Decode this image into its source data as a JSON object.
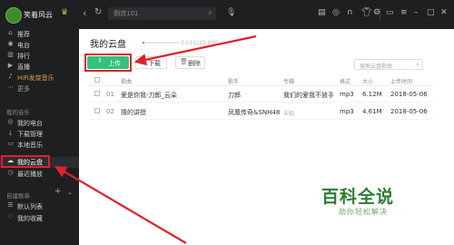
{
  "topbar": {
    "username": "笑着风云",
    "search_value": "倒流101"
  },
  "sidebar": {
    "items": [
      {
        "label": "推荐",
        "icon": "home-icon"
      },
      {
        "label": "电台",
        "icon": "radio-icon"
      },
      {
        "label": "排行",
        "icon": "chart-icon"
      },
      {
        "label": "直播",
        "icon": "live-icon"
      },
      {
        "label": "HiFi发烧音乐",
        "icon": "hifi-icon"
      },
      {
        "label": "更多",
        "icon": "more-icon"
      }
    ],
    "my_music_header": "我的音乐",
    "my_items": [
      {
        "label": "我的电台"
      },
      {
        "label": "下载管理"
      },
      {
        "label": "本地音乐"
      },
      {
        "label": "我的云盘"
      },
      {
        "label": "最近播放"
      }
    ],
    "playlist_header": "自建歌单",
    "playlists": [
      {
        "label": "默认列表"
      },
      {
        "label": "我的收藏"
      }
    ]
  },
  "main": {
    "title": "我的云盘",
    "capacity": "0.01G/10.00G",
    "buttons": {
      "upload": "上传",
      "download": "下载",
      "delete": "删除"
    },
    "search_placeholder": "搜索云盘歌曲",
    "columns": [
      "歌曲",
      "歌手",
      "专辑",
      "格式",
      "大小",
      "上传时间"
    ],
    "rows": [
      {
        "num": "01",
        "title": "爱是你我-刀郎_云朵",
        "artist": "刀郎",
        "album": "我们的爱我不放手",
        "format": "mp3",
        "size": "6.12M",
        "date": "2018-05-06"
      },
      {
        "num": "02",
        "title": "猜的讲授",
        "artist": "凤凰传奇&SNH48",
        "album": "未知",
        "format": "mp3",
        "size": "4.61M",
        "date": "2018-05-06"
      }
    ]
  },
  "watermark": {
    "title": "百科全说",
    "subtitle": "助你轻松解决"
  },
  "colors": {
    "accent": "#31c27c",
    "highlight": "#e0202a",
    "sidebar_bg": "#1e1f21"
  }
}
